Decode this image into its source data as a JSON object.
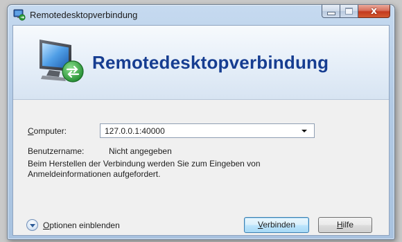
{
  "window": {
    "title": "Remotedesktopverbindung",
    "close_glyph": "x"
  },
  "banner": {
    "title": "Remotedesktopverbindung",
    "icon": "remote-desktop-monitor-icon"
  },
  "form": {
    "computer_label_prefix": "C",
    "computer_label_rest": "omputer:",
    "computer_value": "127.0.0.1:40000",
    "username_label": "Benutzername:",
    "username_value": "Nicht angegeben",
    "info_line1": "Beim Herstellen der Verbindung werden Sie zum Eingeben von",
    "info_line2": "Anmeldeinformationen aufgefordert."
  },
  "footer": {
    "options_prefix": "O",
    "options_rest": "ptionen einblenden",
    "connect_prefix": "V",
    "connect_rest": "erbinden",
    "help_prefix": "H",
    "help_rest": "ilfe"
  },
  "colors": {
    "title_blue": "#163d91",
    "default_button_border": "#3c7fb1"
  }
}
